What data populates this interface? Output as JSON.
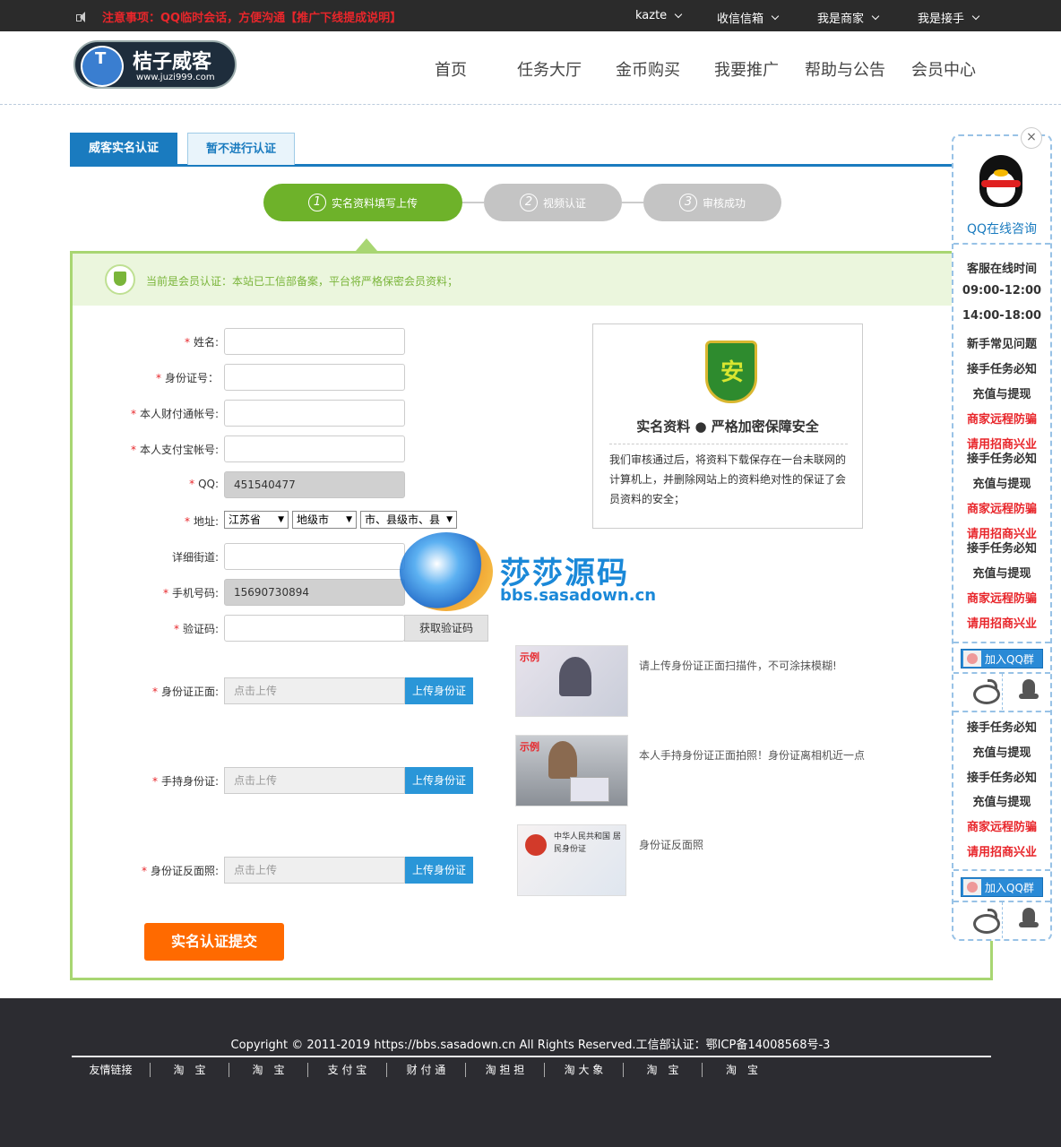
{
  "topbar": {
    "notice": "注意事项：QQ临时会话，方便沟通【推广下线提成说明】",
    "user": "kazte",
    "inbox": "收信信箱",
    "merchant": "我是商家",
    "receiver": "我是接手"
  },
  "logo": {
    "name": "桔子威客",
    "url": "www.juzi999.com"
  },
  "nav": [
    "首页",
    "任务大厅",
    "金币购买",
    "我要推广",
    "帮助与公告",
    "会员中心"
  ],
  "tabs": {
    "active": "威客实名认证",
    "inactive": "暂不进行认证"
  },
  "steps": [
    {
      "num": "1",
      "label": "实名资料填写上传"
    },
    {
      "num": "2",
      "label": "视频认证"
    },
    {
      "num": "3",
      "label": "审核成功"
    }
  ],
  "info": "当前是会员认证：本站已工信部备案，平台将严格保密会员资料；",
  "form": {
    "required_mark": "*",
    "name_label": "姓名:",
    "idcard_label": "身份证号：",
    "tenpay_label": "本人财付通帐号:",
    "alipay_label": "本人支付宝帐号:",
    "qq_label": "QQ:",
    "qq_value": "451540477",
    "address_label": "地址:",
    "province": "江苏省",
    "city": "地级市",
    "county": "市、县级市、县",
    "street_label": "详细街道:",
    "phone_label": "手机号码:",
    "phone_value": "15690730894",
    "code_label": "验证码:",
    "get_code": "获取验证码",
    "id_front_label": "身份证正面:",
    "id_hand_label": "手持身份证:",
    "id_back_label": "身份证反面照:",
    "upload_placeholder": "点击上传",
    "upload_button": "上传身份证",
    "submit": "实名认证提交"
  },
  "security": {
    "title": "实名资料 ● 严格加密保障安全",
    "text": "我们审核通过后，将资料下载保存在一台未联网的计算机上，并删除网站上的资料绝对性的保证了会员资料的安全；"
  },
  "samples": [
    {
      "tag": "示例",
      "note": "请上传身份证正面扫描件，不可涂抹模糊!"
    },
    {
      "tag": "示例",
      "note": "本人手持身份证正面拍照！身份证离相机近一点"
    },
    {
      "tag": "",
      "note": "身份证反面照",
      "card_text": "中华人民共和国 居民身份证"
    }
  ],
  "watermark": {
    "title": "莎莎源码",
    "url": "bbs.sasadown.cn"
  },
  "sidebar": {
    "close": "×",
    "qq_online": "QQ在线咨询",
    "items_a": [
      {
        "text": "客服在线时间",
        "red": false
      },
      {
        "text": "09:00-12:00",
        "red": false
      },
      {
        "text": "14:00-18:00",
        "red": false
      },
      {
        "text": "新手常见问题",
        "red": false
      },
      {
        "text": "接手任务必知",
        "red": false
      },
      {
        "text": "充值与提现",
        "red": false
      },
      {
        "text": "商家远程防骗",
        "red": true
      },
      {
        "text": "请用招商兴业",
        "red": true
      },
      {
        "text": "接手任务必知",
        "red": false
      },
      {
        "text": "充值与提现",
        "red": false
      },
      {
        "text": "商家远程防骗",
        "red": true
      },
      {
        "text": "请用招商兴业",
        "red": true
      },
      {
        "text": "接手任务必知",
        "red": false
      },
      {
        "text": "充值与提现",
        "red": false
      },
      {
        "text": "商家远程防骗",
        "red": true
      },
      {
        "text": "请用招商兴业",
        "red": true
      }
    ],
    "items_b": [
      {
        "text": "接手任务必知",
        "red": false
      },
      {
        "text": "充值与提现",
        "red": false
      },
      {
        "text": "接手任务必知",
        "red": false
      },
      {
        "text": "充值与提现",
        "red": false
      },
      {
        "text": "商家远程防骗",
        "red": true
      },
      {
        "text": "请用招商兴业",
        "red": true
      }
    ],
    "qq_group": "加入QQ群"
  },
  "footer": {
    "copyright": "Copyright © 2011-2019 https://bbs.sasadown.cn All Rights Reserved.工信部认证：鄂ICP备14008568号-3",
    "links": [
      "友情链接",
      "淘　宝",
      "淘　宝",
      "支 付 宝",
      "财 付 通",
      "淘 担 担",
      "淘 大 象",
      "淘　宝",
      "淘　宝"
    ]
  },
  "colors": {
    "accent": "#1a7bbf",
    "green": "#6eb22a",
    "orange": "#ff6a00",
    "red": "#e8262b"
  }
}
